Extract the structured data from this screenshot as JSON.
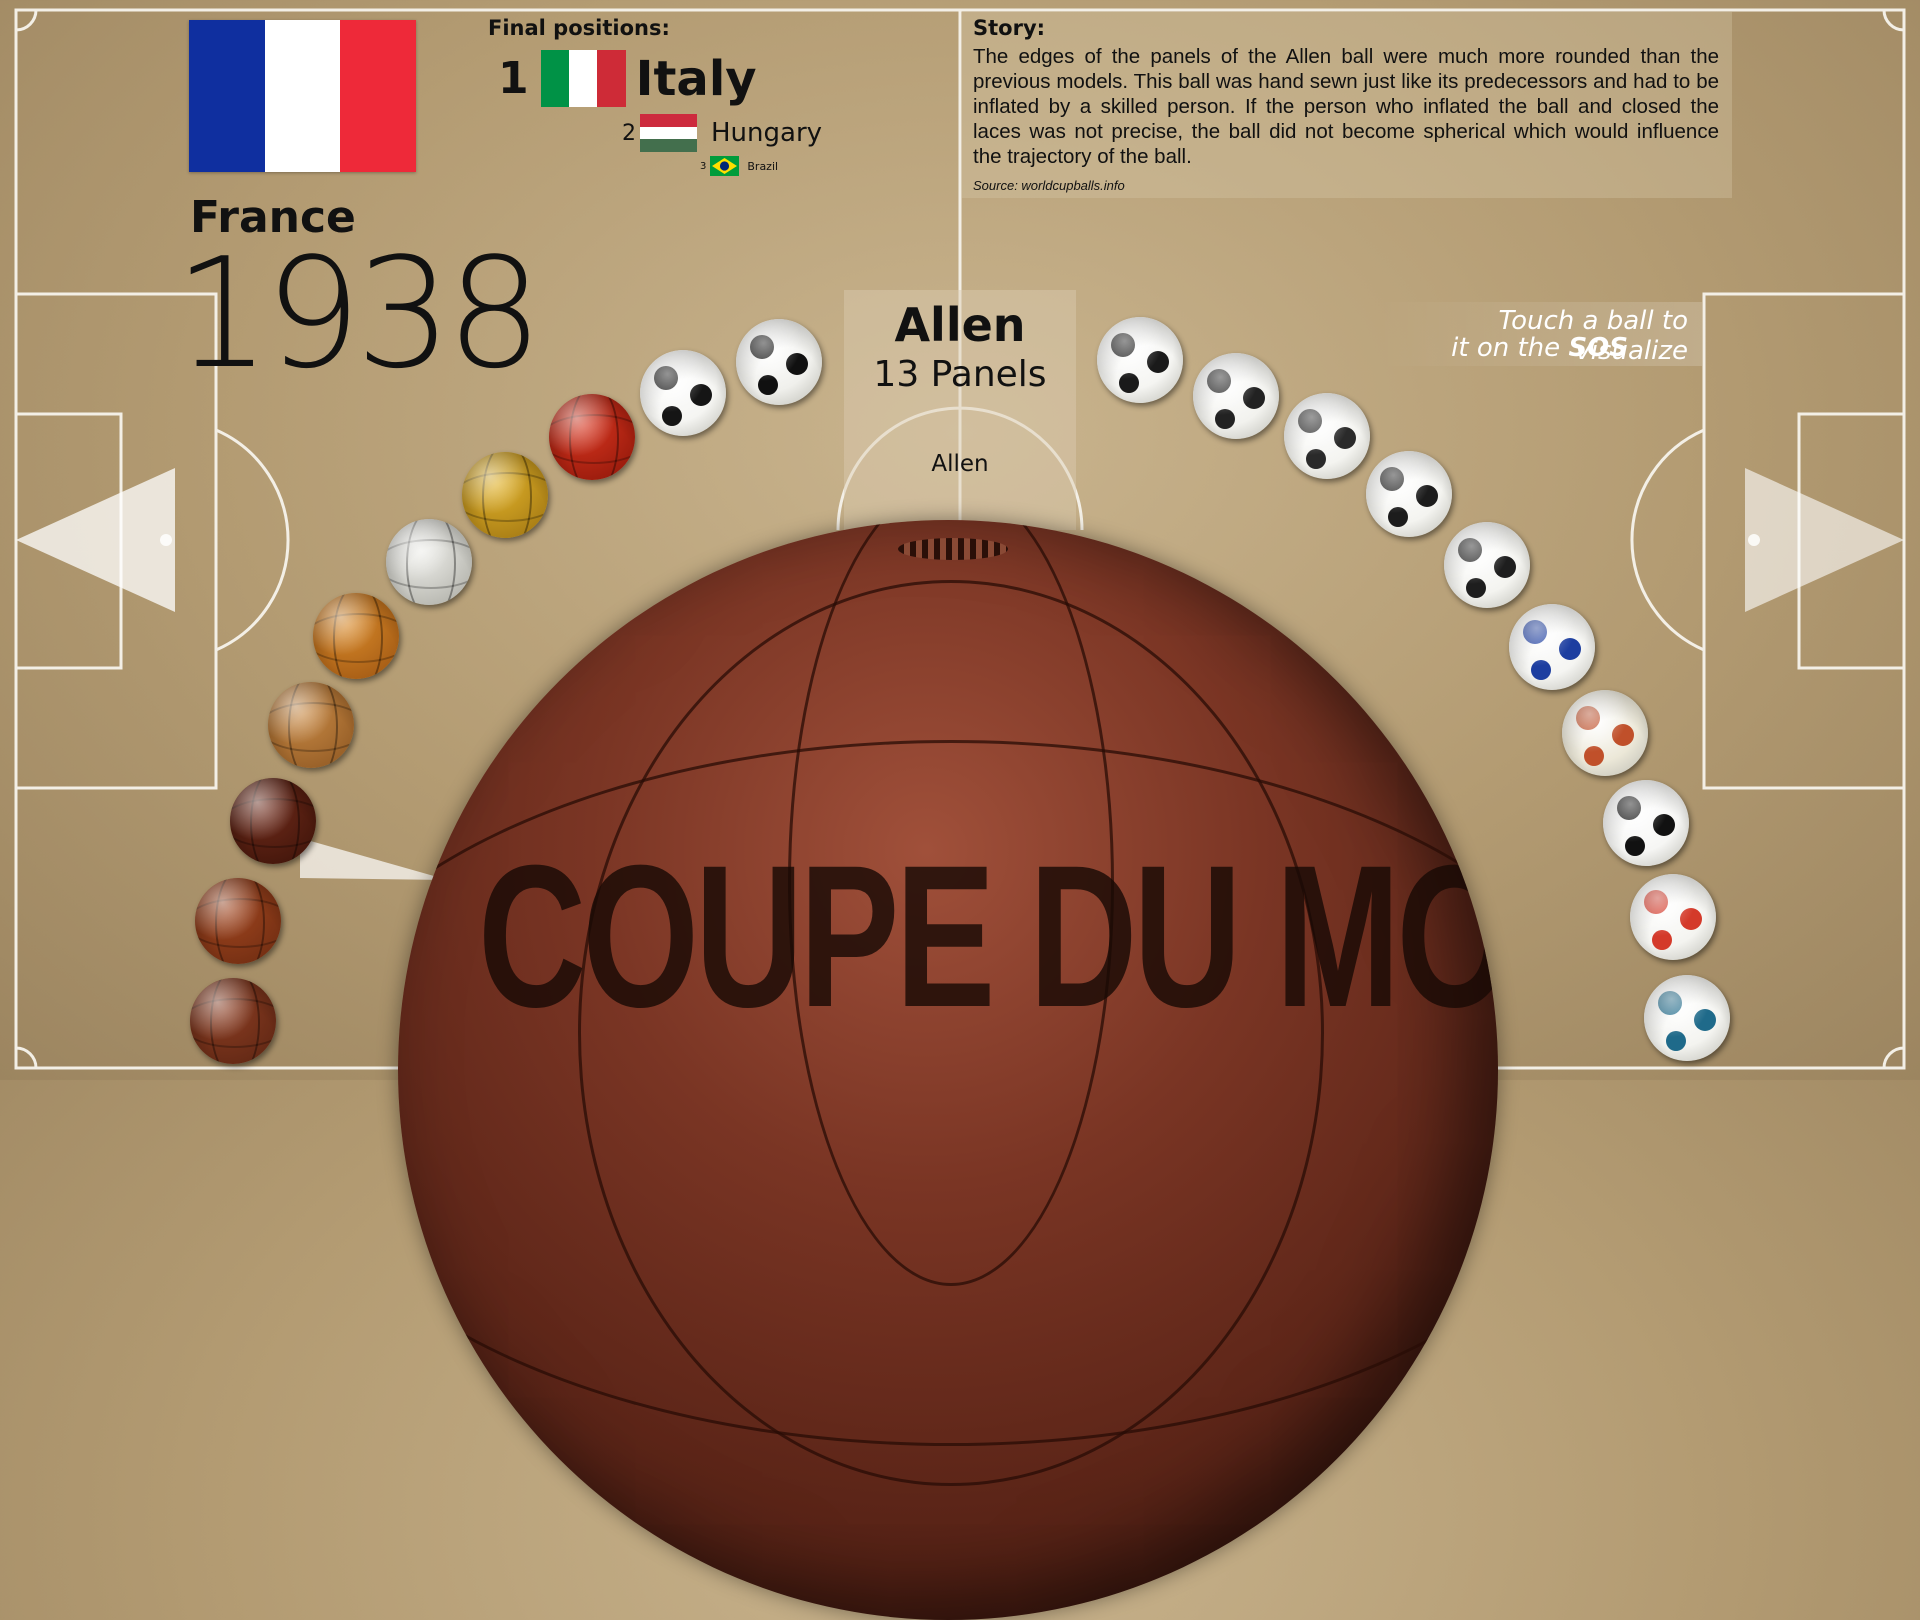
{
  "host": {
    "country": "France",
    "year": "1938",
    "flag_colors": [
      "#0f2f9f",
      "#ffffff",
      "#ee2939"
    ]
  },
  "final_positions": {
    "title": "Final positions:",
    "entries": [
      {
        "rank": "1",
        "team": "Italy",
        "flag_colors": [
          "#009246",
          "#ffffff",
          "#ce2b37"
        ],
        "flag_orientation": "vertical-stripes"
      },
      {
        "rank": "2",
        "team": "Hungary",
        "flag_colors": [
          "#cd2a3e",
          "#ffffff",
          "#436f4d"
        ],
        "flag_orientation": "horizontal-stripes"
      },
      {
        "rank": "3",
        "team": "Brazil",
        "flag_colors": [
          "#009c3b",
          "#ffdf00",
          "#002776"
        ],
        "flag_orientation": "diamond"
      }
    ]
  },
  "story": {
    "title": "Story:",
    "text": "The edges of the panels of the Allen ball were much more rounded than the previous models. This ball was hand sewn just like its predecessors and had to be inflated by a skilled person. If the person who inflated the ball and closed the laces was not precise, the ball did not become spherical which would influence the trajectory of the ball.",
    "source": "Source: worldcupballs.info"
  },
  "selected_ball": {
    "name": "Allen",
    "panels": "13 Panels",
    "center_label": "Allen",
    "print_text": "COUPE DU MONDE"
  },
  "hint": {
    "line1": "Touch a ball to visualize",
    "line2_prefix": "it on the ",
    "line2_bold": "SOS"
  },
  "balls": [
    {
      "id": "ball-1930",
      "style": "brown-leather",
      "colors": [
        "#8b3d22",
        "#5a2412"
      ]
    },
    {
      "id": "ball-1934",
      "style": "brown-leather",
      "colors": [
        "#a0451f",
        "#6a2a10"
      ]
    },
    {
      "id": "ball-1938",
      "style": "dark-brown-leather",
      "colors": [
        "#6e2a1a",
        "#3a1208"
      ],
      "selected": true
    },
    {
      "id": "ball-1950",
      "style": "tan-leather",
      "colors": [
        "#c98a45",
        "#8a5420"
      ]
    },
    {
      "id": "ball-1954",
      "style": "orange-leather",
      "colors": [
        "#d98a2a",
        "#9a5210"
      ]
    },
    {
      "id": "ball-1958",
      "style": "white-leather",
      "colors": [
        "#f2f2ee",
        "#a8a8a0"
      ]
    },
    {
      "id": "ball-1962",
      "style": "yellow-leather",
      "colors": [
        "#e2b32a",
        "#9a7010"
      ]
    },
    {
      "id": "ball-1966",
      "style": "red-leather",
      "colors": [
        "#d8351f",
        "#8a1508"
      ]
    },
    {
      "id": "ball-1970",
      "style": "telstar",
      "colors": [
        "#f5f5f2",
        "#151515"
      ]
    },
    {
      "id": "ball-1974",
      "style": "telstar",
      "colors": [
        "#f0f0ec",
        "#101010"
      ]
    },
    {
      "id": "ball-1978",
      "style": "tango",
      "colors": [
        "#f5f5f2",
        "#1a1a1a"
      ]
    },
    {
      "id": "ball-1982",
      "style": "tango",
      "colors": [
        "#f2f2ee",
        "#222222"
      ]
    },
    {
      "id": "ball-1986",
      "style": "azteca",
      "colors": [
        "#f4f4f0",
        "#2a2a2a"
      ]
    },
    {
      "id": "ball-1990",
      "style": "etrusco",
      "colors": [
        "#f4f4f0",
        "#1c1c1c"
      ]
    },
    {
      "id": "ball-1994",
      "style": "questra",
      "colors": [
        "#f4f4f0",
        "#1e1e1e"
      ]
    },
    {
      "id": "ball-1998",
      "style": "tricolore",
      "colors": [
        "#f5f5f2",
        "#1d3ea0"
      ]
    },
    {
      "id": "ball-2002",
      "style": "fevernova",
      "colors": [
        "#ece8d8",
        "#c0502a"
      ]
    },
    {
      "id": "ball-2006",
      "style": "teamgeist",
      "colors": [
        "#f6f6f4",
        "#111111"
      ]
    },
    {
      "id": "ball-2010",
      "style": "jabulani",
      "colors": [
        "#f4f4f0",
        "#d43a2a"
      ]
    },
    {
      "id": "ball-2014",
      "style": "brazuca",
      "colors": [
        "#f4f4f0",
        "#1f6a8a"
      ]
    }
  ]
}
